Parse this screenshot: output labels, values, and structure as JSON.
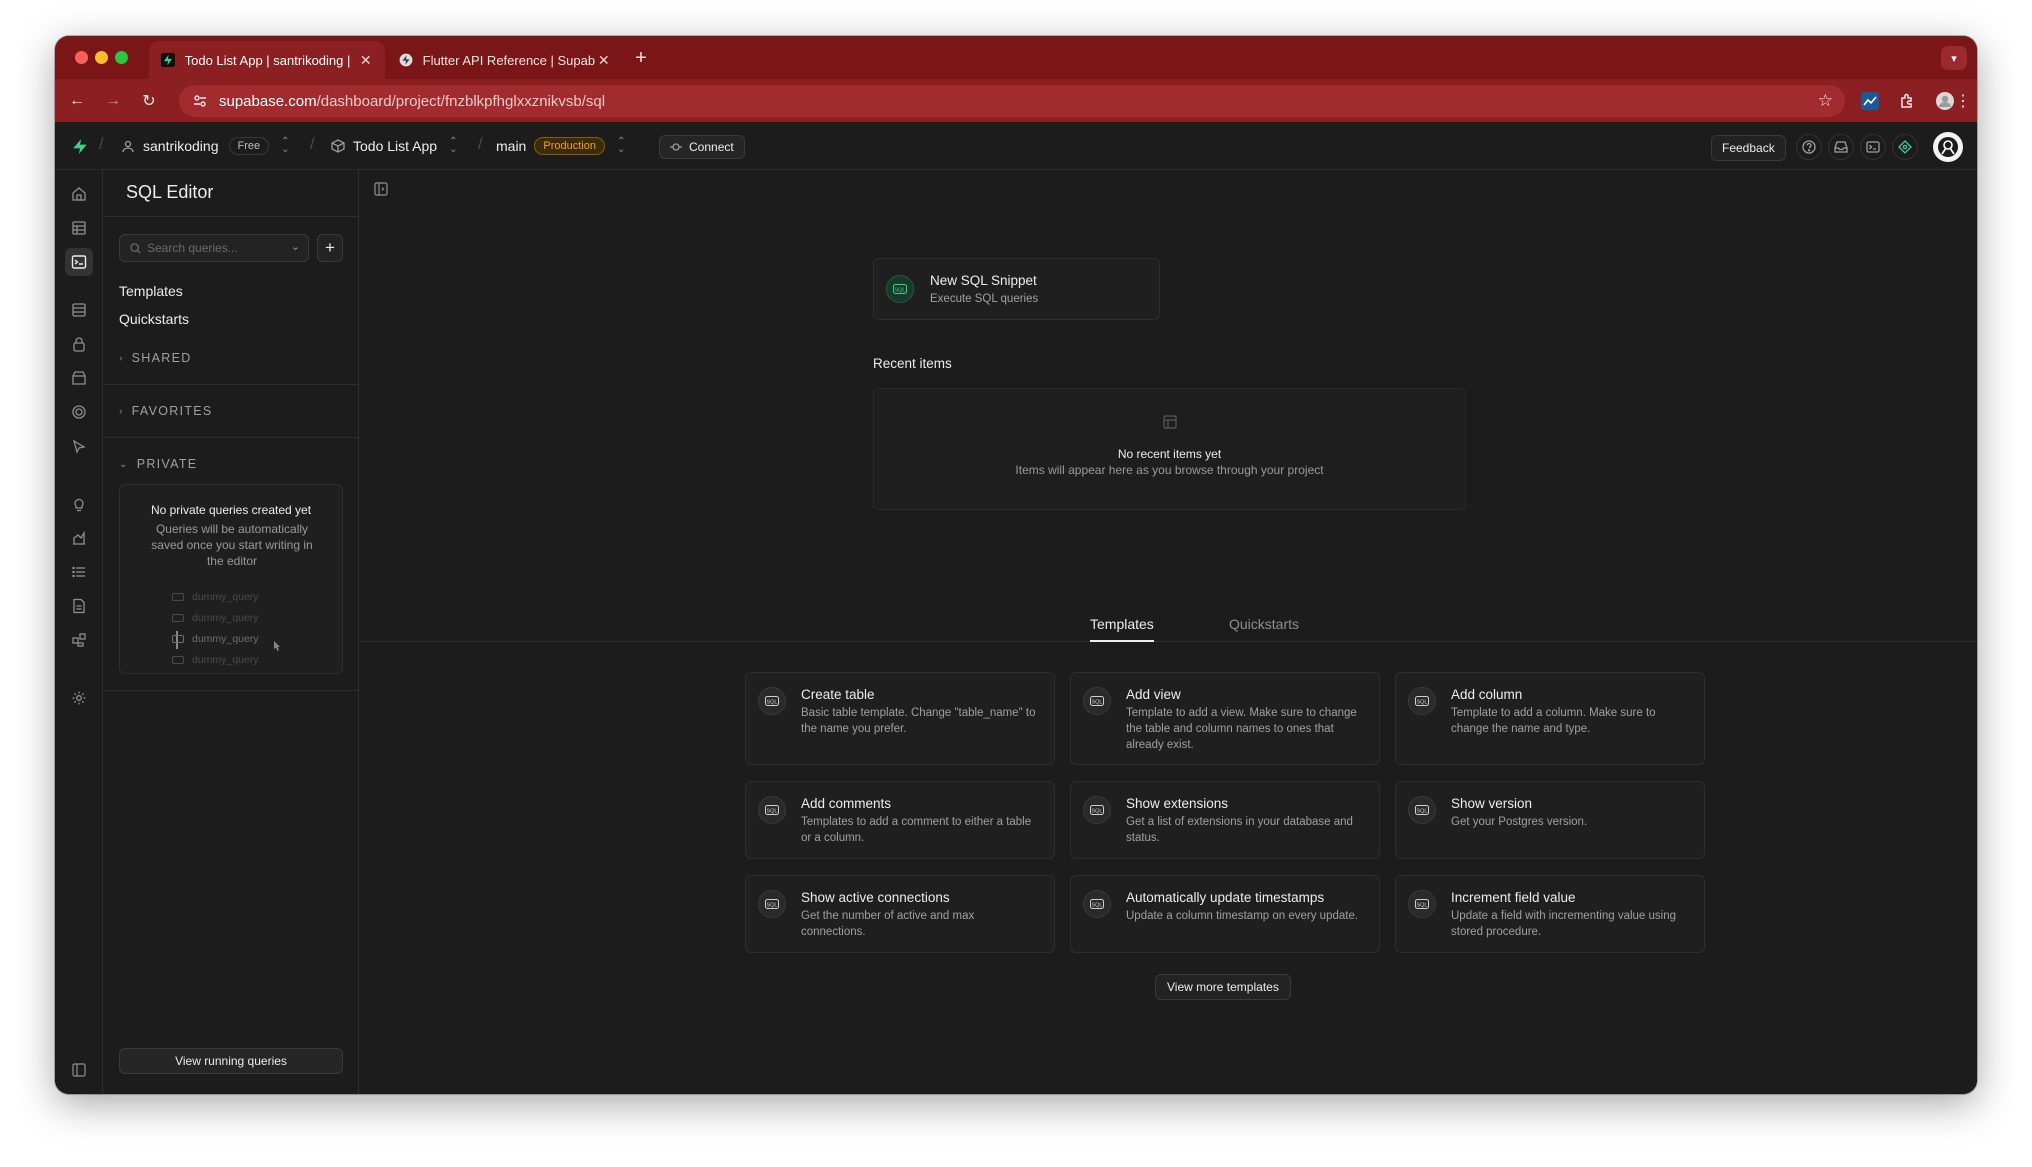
{
  "browser": {
    "tabs": [
      {
        "title": "Todo List App | santrikoding |",
        "active": true
      },
      {
        "title": "Flutter API Reference | Supab",
        "active": false
      }
    ],
    "url_domain": "supabase.com",
    "url_path": "/dashboard/project/fnzblkpfhglxxznikvsb/sql"
  },
  "header": {
    "org_name": "santrikoding",
    "org_plan": "Free",
    "project_name": "Todo List App",
    "branch_name": "main",
    "branch_env": "Production",
    "connect_label": "Connect",
    "feedback_label": "Feedback"
  },
  "sidebar": {
    "title": "SQL Editor",
    "search_placeholder": "Search queries...",
    "links": [
      "Templates",
      "Quickstarts"
    ],
    "sections": [
      "SHARED",
      "FAVORITES",
      "PRIVATE"
    ],
    "private_empty_title": "No private queries created yet",
    "private_empty_desc": "Queries will be automatically saved once you start writing in the editor",
    "dummy_queries": [
      "dummy_query",
      "dummy_query",
      "dummy_query",
      "dummy_query"
    ],
    "running_queries_label": "View running queries"
  },
  "main": {
    "snippet_title": "New SQL Snippet",
    "snippet_desc": "Execute SQL queries",
    "recent_title": "Recent items",
    "recent_empty": "No recent items yet",
    "recent_hint": "Items will appear here as you browse through your project",
    "tabs": [
      "Templates",
      "Quickstarts"
    ],
    "templates": [
      {
        "title": "Create table",
        "desc": "Basic table template. Change \"table_name\" to the name you prefer."
      },
      {
        "title": "Add view",
        "desc": "Template to add a view. Make sure to change the table and column names to ones that already exist."
      },
      {
        "title": "Add column",
        "desc": "Template to add a column. Make sure to change the name and type."
      },
      {
        "title": "Add comments",
        "desc": "Templates to add a comment to either a table or a column."
      },
      {
        "title": "Show extensions",
        "desc": "Get a list of extensions in your database and status."
      },
      {
        "title": "Show version",
        "desc": "Get your Postgres version."
      },
      {
        "title": "Show active connections",
        "desc": "Get the number of active and max connections."
      },
      {
        "title": "Automatically update timestamps",
        "desc": "Update a column timestamp on every update."
      },
      {
        "title": "Increment field value",
        "desc": "Update a field with incrementing value using stored procedure."
      }
    ],
    "view_more_label": "View more templates"
  },
  "icons": {
    "sql": "SQL",
    "brand_color": "#3ecf8e",
    "chrome_accent": "#8c1f21"
  }
}
